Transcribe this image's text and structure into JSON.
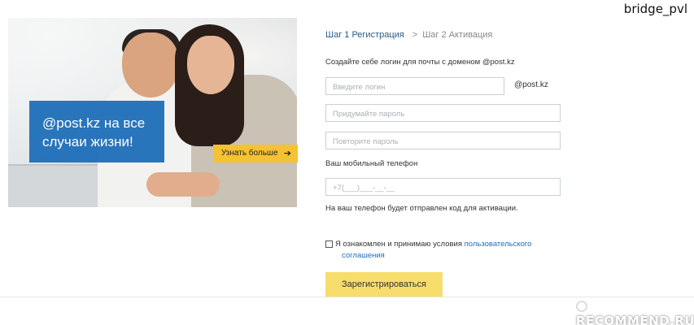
{
  "header": {
    "username": "bridge_pvl"
  },
  "promo": {
    "headline_line1": "@post.kz на все",
    "headline_line2": "случаи жизни!",
    "more_label": "Узнать больше",
    "arrow_icon": "arrow-right-icon"
  },
  "steps": {
    "step1": "Шаг 1 Регистрация",
    "separator": ">",
    "step2": "Шаг 2 Активация"
  },
  "form": {
    "intro": "Создайте себе логин для почты с доменом @post.kz",
    "login_placeholder": "Введите логин",
    "domain": "@post.kz",
    "password_placeholder": "Придумайте пароль",
    "password_repeat_placeholder": "Повторите пароль",
    "phone_label": "Ваш мобильный телефон",
    "phone_placeholder": "+7(___)___-__-__",
    "phone_hint": "На ваш телефон будет отправлен код для активации.",
    "agree_text": "Я ознакомлен и принимаю условия ",
    "agree_link1": "пользовательского",
    "agree_link2": "соглашения",
    "submit_label": "Зарегистрироваться"
  },
  "watermark": {
    "text": "RECOMMEND.RU"
  },
  "colors": {
    "brand_blue": "#1f6fba",
    "button_yellow": "#f7dd6b",
    "promo_yellow": "#f4c233"
  }
}
